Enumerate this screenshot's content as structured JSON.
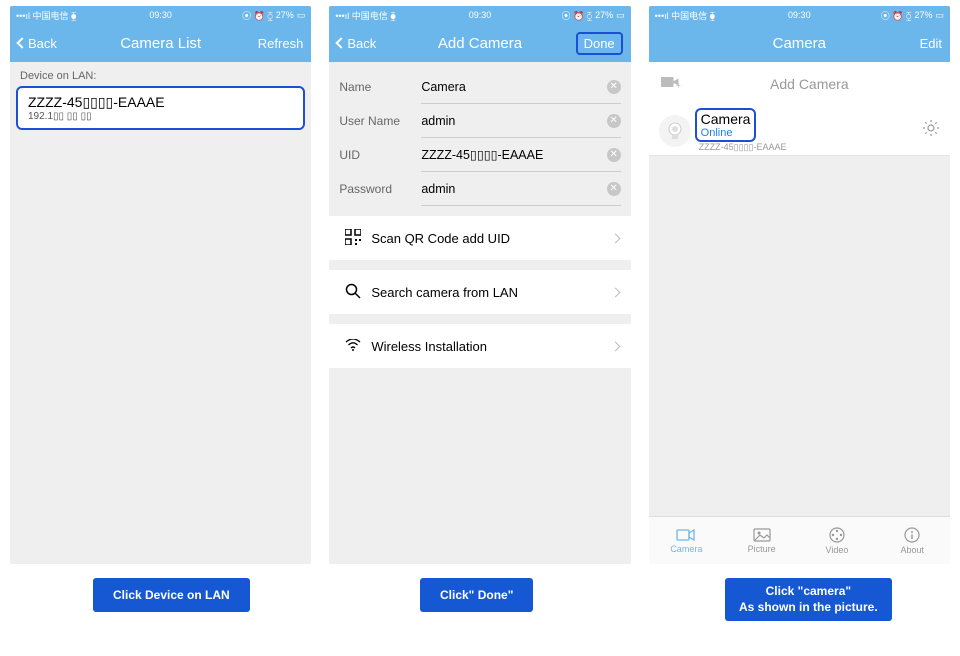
{
  "status": {
    "carrier": "中国电信",
    "time": "09:30",
    "battery": "27%",
    "signal": "•••ıl",
    "wifi": "⧳",
    "icons": "⦿ ⏰ ⧲"
  },
  "s1": {
    "back": "Back",
    "title": "Camera List",
    "action": "Refresh",
    "section": "Device on LAN:",
    "device_name": "ZZZZ-45▯▯▯▯-EAAAE",
    "device_ip": "192.1▯▯ ▯▯ ▯▯"
  },
  "s2": {
    "back": "Back",
    "title": "Add Camera",
    "action": "Done",
    "name_label": "Name",
    "name_value": "Camera",
    "user_label": "User Name",
    "user_value": "admin",
    "uid_label": "UID",
    "uid_value": "ZZZZ-45▯▯▯▯-EAAAE",
    "pw_label": "Password",
    "pw_value": "admin",
    "opt1": "Scan QR Code add UID",
    "opt2": "Search camera from LAN",
    "opt3": "Wireless Installation"
  },
  "s3": {
    "title": "Camera",
    "action": "Edit",
    "add": "Add Camera",
    "cam_name": "Camera",
    "cam_status": "Online",
    "cam_uid": "ZZZZ-45▯▯▯▯-EAAAE",
    "tabs": {
      "camera": "Camera",
      "picture": "Picture",
      "video": "Video",
      "about": "About"
    }
  },
  "captions": {
    "c1": "Click Device on LAN",
    "c2": "Click\" Done\"",
    "c3_l1": "Click \"camera\"",
    "c3_l2": "As shown in the picture."
  }
}
